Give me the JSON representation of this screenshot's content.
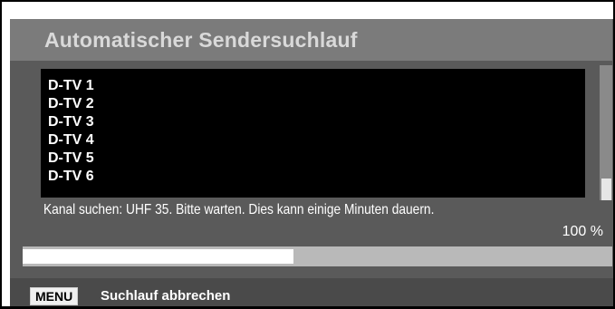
{
  "dialog": {
    "title": "Automatischer Sendersuchlauf"
  },
  "channels": [
    "D-TV 1",
    "D-TV 2",
    "D-TV 3",
    "D-TV 4",
    "D-TV 5",
    "D-TV 6"
  ],
  "status": {
    "message": "Kanal suchen: UHF 35. Bitte warten. Dies kann einige Minuten dauern.",
    "percent_label": "100 %"
  },
  "progress": {
    "fraction_filled": 0.46
  },
  "footer": {
    "key_label": "MENU",
    "action_label": "Suchlauf abbrechen"
  },
  "colors": {
    "panel_bg": "#5a5a5a",
    "title_bg": "#7b7b7b",
    "title_text": "#d9d9d9",
    "list_bg": "#000000",
    "progress_track": "#b9b9b9",
    "progress_fill": "#ffffff"
  }
}
